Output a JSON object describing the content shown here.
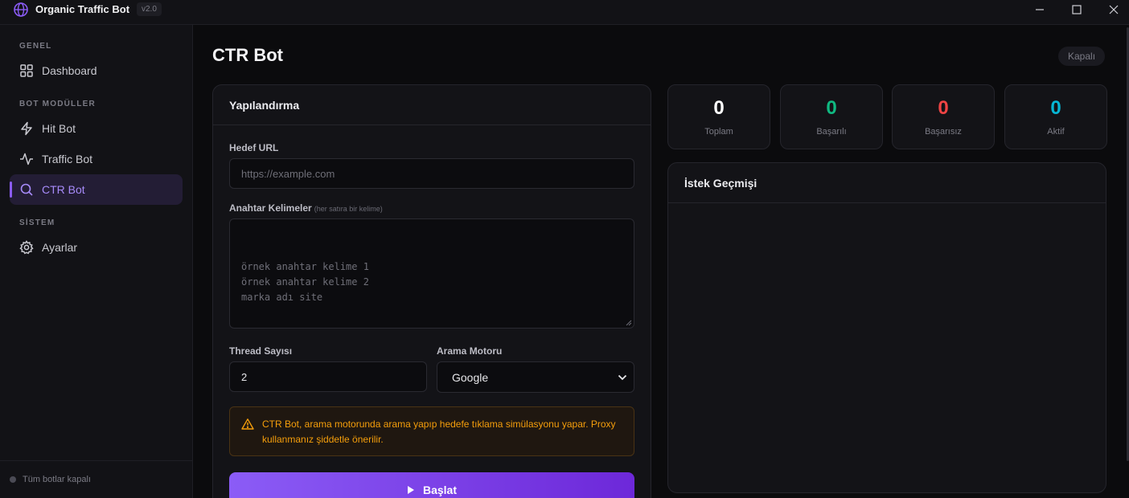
{
  "app": {
    "title": "Organic Traffic Bot",
    "version": "v2.0"
  },
  "sidebar": {
    "sections": [
      {
        "label": "GENEL",
        "items": [
          {
            "label": "Dashboard",
            "icon": "grid-icon"
          }
        ]
      },
      {
        "label": "BOT MODÜLLER",
        "items": [
          {
            "label": "Hit Bot",
            "icon": "lightning-icon"
          },
          {
            "label": "Traffic Bot",
            "icon": "activity-icon"
          },
          {
            "label": "CTR Bot",
            "icon": "search-icon",
            "active": true
          }
        ]
      },
      {
        "label": "SİSTEM",
        "items": [
          {
            "label": "Ayarlar",
            "icon": "gear-icon"
          }
        ]
      }
    ],
    "footer_status": "Tüm botlar kapalı"
  },
  "page": {
    "title": "CTR Bot",
    "status_badge": "Kapalı"
  },
  "config": {
    "header": "Yapılandırma",
    "target_url": {
      "label": "Hedef URL",
      "placeholder": "https://example.com"
    },
    "keywords": {
      "label": "Anahtar Kelimeler",
      "hint": "(her satıra bir kelime)",
      "placeholder": "örnek anahtar kelime 1\nörnek anahtar kelime 2\nmarka adı site"
    },
    "thread_count": {
      "label": "Thread Sayısı",
      "value": "2"
    },
    "search_engine": {
      "label": "Arama Motoru",
      "value": "Google"
    },
    "warning": "CTR Bot, arama motorunda arama yapıp hedefe tıklama simülasyonu yapar. Proxy kullanmanız şiddetle önerilir.",
    "start_label": "Başlat"
  },
  "stats": [
    {
      "value": "0",
      "label": "Toplam",
      "color": "#ffffff"
    },
    {
      "value": "0",
      "label": "Başarılı",
      "color": "#10b981"
    },
    {
      "value": "0",
      "label": "Başarısız",
      "color": "#ef4444"
    },
    {
      "value": "0",
      "label": "Aktif",
      "color": "#06b6d4"
    }
  ],
  "history": {
    "header": "İstek Geçmişi"
  },
  "colors": {
    "accent": "#8b5cf6",
    "warning": "#f59e0b"
  }
}
